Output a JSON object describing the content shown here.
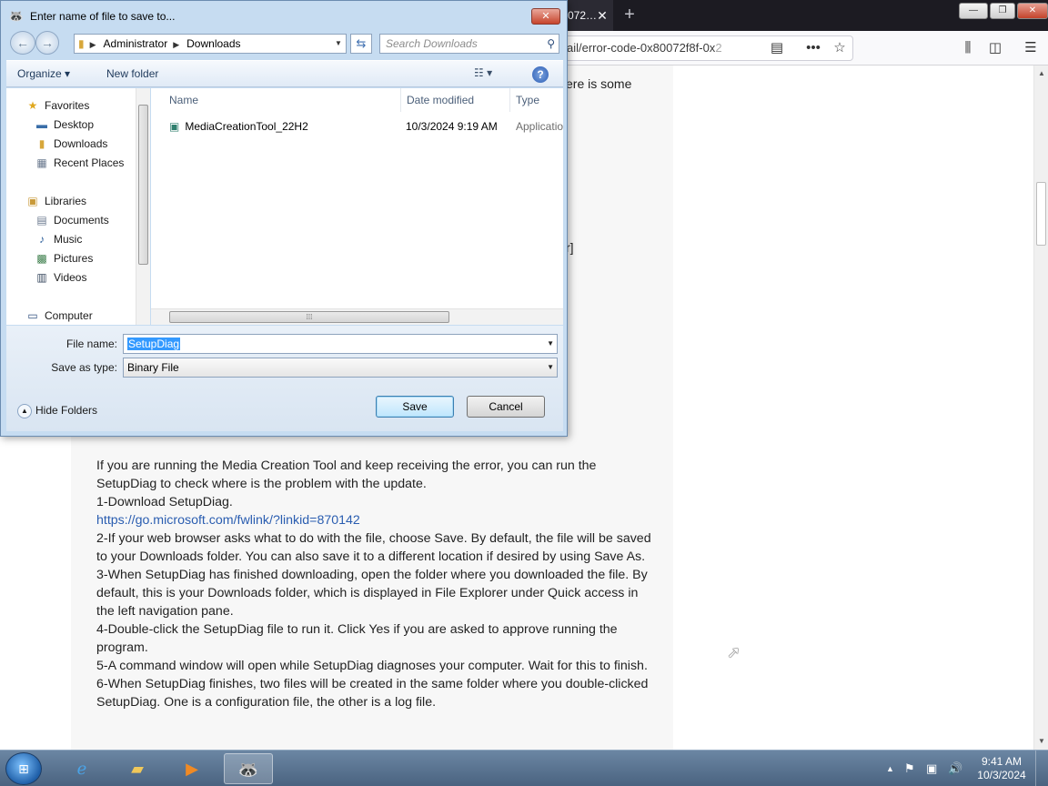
{
  "browser": {
    "tab_title": "072…",
    "tab_close": "✕",
    "new_tab": "+",
    "url_visible": "ail/error-code-0x80072f8f-0x",
    "url_faded": "2",
    "nav_icons": [
      "reader-view-icon",
      "more-icon",
      "bookmark-star-icon",
      "library-icon",
      "sidebar-icon",
      "menu-icon"
    ],
    "peek_text_1": "ere is some",
    "peek_text_2": "r]",
    "article_paragraphs": [
      "If you are running the Media Creation Tool and keep receiving the error, you can run the SetupDiag to check where is the problem with the update.",
      "1-Download SetupDiag.",
      "https://go.microsoft.com/fwlink/?linkid=870142",
      "2-If your web browser asks what to do with the file, choose Save. By default, the file will be saved to your Downloads folder. You can also save it to a different location if desired by using Save As.",
      "3-When SetupDiag has finished downloading, open the folder where you downloaded the file. By default, this is your Downloads folder, which is displayed in File Explorer under Quick access in the left navigation pane.",
      "4-Double-click the SetupDiag file to run it. Click Yes if you are asked to approve running the program.",
      "5-A command window will open while SetupDiag diagnoses your computer. Wait for this to finish.",
      "6-When SetupDiag finishes, two files will be created in the same folder where you double-clicked SetupDiag. One is a configuration file, the other is a log file."
    ]
  },
  "dialog": {
    "title": "Enter name of file to save to...",
    "close": "✕",
    "breadcrumb": [
      "Administrator",
      "Downloads"
    ],
    "search_placeholder": "Search Downloads",
    "toolbar": {
      "organize": "Organize ▾",
      "new_folder": "New folder",
      "view": "☷ ▾",
      "help": "?"
    },
    "nav": {
      "favorites": "Favorites",
      "desktop": "Desktop",
      "downloads": "Downloads",
      "recent_places": "Recent Places",
      "libraries": "Libraries",
      "documents": "Documents",
      "music": "Music",
      "pictures": "Pictures",
      "videos": "Videos",
      "computer": "Computer"
    },
    "columns": {
      "name": "Name",
      "date_modified": "Date modified",
      "type": "Type"
    },
    "files": [
      {
        "name": "MediaCreationTool_22H2",
        "date": "10/3/2024 9:19 AM",
        "type": "Applicatio"
      }
    ],
    "file_name_label": "File name:",
    "file_name_value": "SetupDiag",
    "save_type_label": "Save as type:",
    "save_type_value": "Binary File",
    "hide_folders": "Hide Folders",
    "save_button": "Save",
    "cancel_button": "Cancel"
  },
  "taskbar": {
    "start": "⊞",
    "time": "9:41 AM",
    "date": "10/3/2024"
  }
}
